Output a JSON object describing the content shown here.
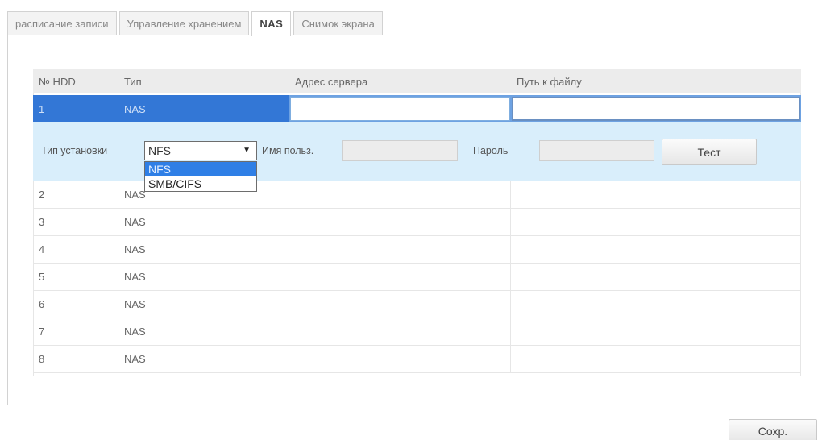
{
  "tabs": [
    {
      "label": "расписание записи",
      "active": false
    },
    {
      "label": "Управление хранением",
      "active": false
    },
    {
      "label": "NAS",
      "active": true
    },
    {
      "label": "Снимок экрана",
      "active": false
    }
  ],
  "table": {
    "headers": [
      "№ HDD",
      "Тип",
      "Адрес сервера",
      "Путь к файлу"
    ],
    "selected_row": {
      "hdd": "1",
      "type": "NAS",
      "server_address": "",
      "file_path": ""
    },
    "rows": [
      {
        "hdd": "2",
        "type": "NAS"
      },
      {
        "hdd": "3",
        "type": "NAS"
      },
      {
        "hdd": "4",
        "type": "NAS"
      },
      {
        "hdd": "5",
        "type": "NAS"
      },
      {
        "hdd": "6",
        "type": "NAS"
      },
      {
        "hdd": "7",
        "type": "NAS"
      },
      {
        "hdd": "8",
        "type": "NAS"
      }
    ]
  },
  "settings": {
    "mount_type_label": "Тип установки",
    "mount_type_value": "NFS",
    "mount_type_options": [
      "NFS",
      "SMB/CIFS"
    ],
    "username_label": "Имя польз.",
    "username_value": "",
    "password_label": "Пароль",
    "password_value": "",
    "test_button": "Тест"
  },
  "save_button": "Сохр.",
  "colors": {
    "selected_row": "#6ea2e2",
    "selected_cell": "#3377d6",
    "settings_bg": "#d9eefb",
    "header_bg": "#ececec",
    "dropdown_highlight": "#2f7fe6"
  },
  "icons": {
    "dropdown_arrow": "caret-down-icon"
  }
}
